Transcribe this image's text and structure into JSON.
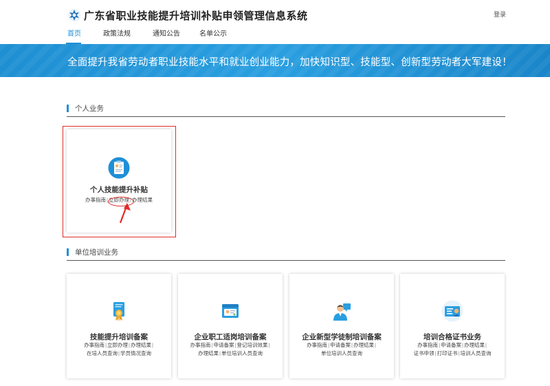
{
  "header": {
    "title": "广东省职业技能提升培训补贴申领管理信息系统",
    "login": "登录"
  },
  "nav": [
    {
      "label": "首页",
      "active": true
    },
    {
      "label": "政策法规",
      "active": false
    },
    {
      "label": "通知公告",
      "active": false
    },
    {
      "label": "名单公示",
      "active": false
    }
  ],
  "banner": {
    "text": "全面提升我省劳动者职业技能水平和就业创业能力，加快知识型、技能型、创新型劳动者大军建设！"
  },
  "personal": {
    "heading": "个人业务",
    "card": {
      "title": "个人技能提升补贴",
      "links": [
        "办事指南",
        "立即办理",
        "办理结果"
      ],
      "icon": "clipboard-person-icon"
    }
  },
  "unit": {
    "heading": "单位培训业务",
    "cards": [
      {
        "title": "技能提升培训备案",
        "line1": [
          "办事指南",
          "立即办理",
          "办理结果"
        ],
        "line2": [
          "在培人员查询",
          "学员情况查询"
        ],
        "icon": "certificate-medal-icon"
      },
      {
        "title": "企业职工适岗培训备案",
        "line1": [
          "办事指南",
          "申请备案",
          "登记培训效果"
        ],
        "line2": [
          "办理结果",
          "单位培训人员查询"
        ],
        "icon": "id-card-icon"
      },
      {
        "title": "企业新型学徒制培训备案",
        "line1": [
          "办事指南",
          "申请备案",
          "办理结果"
        ],
        "line2": [
          "单位培训人员查询"
        ],
        "icon": "apprentice-person-icon"
      },
      {
        "title": "培训合格证书业务",
        "line1": [
          "办事指南",
          "申请备案",
          "办理结果"
        ],
        "line2": [
          "证书申领",
          "打印证书",
          "培训人员查询"
        ],
        "icon": "certificate-badge-icon"
      }
    ]
  },
  "colors": {
    "accent": "#1f8fd6",
    "banner": "#2a9fe0",
    "highlight": "#e02a2a"
  }
}
